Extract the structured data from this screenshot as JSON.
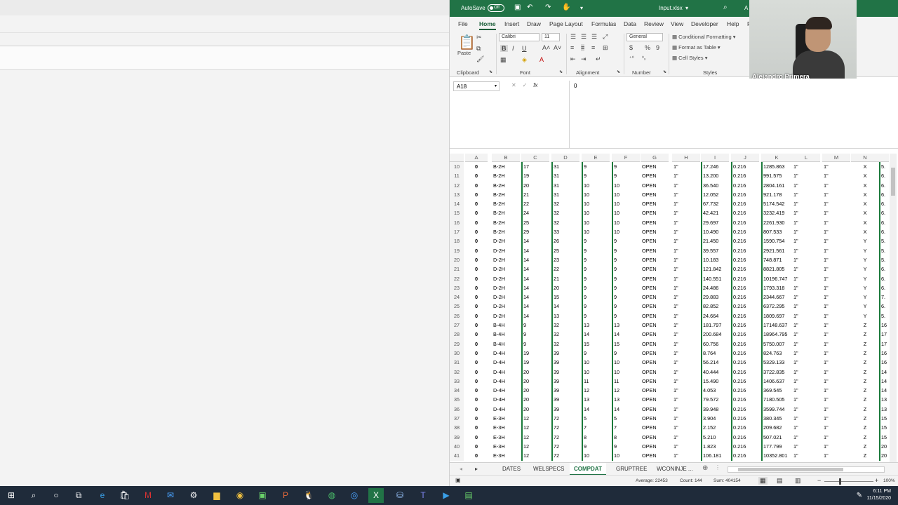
{
  "excel": {
    "autosave": "AutoSave",
    "autosave_state": "Off",
    "filename": "Input.xlsx",
    "title_extra": "A",
    "tabs": [
      "File",
      "Home",
      "Insert",
      "Draw",
      "Page Layout",
      "Formulas",
      "Data",
      "Review",
      "View",
      "Developer",
      "Help",
      "F"
    ],
    "active_tab": "Home",
    "clipboard": {
      "paste": "Paste",
      "group": "Clipboard"
    },
    "font": {
      "name": "Calibri",
      "size": "11",
      "group": "Font"
    },
    "alignment": {
      "group": "Alignment"
    },
    "number": {
      "format": "General",
      "currency": "$",
      "percent": "%",
      "comma": "9",
      "group": "Number"
    },
    "styles": {
      "conditional": "Conditional Formatting",
      "format_table": "Format as Table",
      "cell_styles": "Cell Styles",
      "group": "Styles"
    },
    "name_box": "A18",
    "formula_value": "0",
    "columns": [
      "A",
      "B",
      "C",
      "D",
      "E",
      "F",
      "G",
      "H",
      "I",
      "J",
      "K",
      "L",
      "M",
      "N"
    ],
    "rows": [
      {
        "r": "10",
        "a": "0",
        "b": "B-2H",
        "c": "17",
        "d": "31",
        "e": "9",
        "f": "9",
        "g": "OPEN",
        "h": "1\"",
        "i": "17.246",
        "j": "0.216",
        "k": "1285.863",
        "l": "1\"",
        "m": "1\"",
        "n": "X",
        "o": "5."
      },
      {
        "r": "11",
        "a": "0",
        "b": "B-2H",
        "c": "19",
        "d": "31",
        "e": "9",
        "f": "9",
        "g": "OPEN",
        "h": "1\"",
        "i": "13.200",
        "j": "0.216",
        "k": "991.575",
        "l": "1\"",
        "m": "1\"",
        "n": "X",
        "o": "6."
      },
      {
        "r": "12",
        "a": "0",
        "b": "B-2H",
        "c": "20",
        "d": "31",
        "e": "10",
        "f": "10",
        "g": "OPEN",
        "h": "1\"",
        "i": "36.540",
        "j": "0.216",
        "k": "2804.161",
        "l": "1\"",
        "m": "1\"",
        "n": "X",
        "o": "6."
      },
      {
        "r": "13",
        "a": "0",
        "b": "B-2H",
        "c": "21",
        "d": "31",
        "e": "10",
        "f": "10",
        "g": "OPEN",
        "h": "1\"",
        "i": "12.052",
        "j": "0.216",
        "k": "921.178",
        "l": "1\"",
        "m": "1\"",
        "n": "X",
        "o": "6."
      },
      {
        "r": "14",
        "a": "0",
        "b": "B-2H",
        "c": "22",
        "d": "32",
        "e": "10",
        "f": "10",
        "g": "OPEN",
        "h": "1\"",
        "i": "67.732",
        "j": "0.216",
        "k": "5174.542",
        "l": "1\"",
        "m": "1\"",
        "n": "X",
        "o": "6."
      },
      {
        "r": "15",
        "a": "0",
        "b": "B-2H",
        "c": "24",
        "d": "32",
        "e": "10",
        "f": "10",
        "g": "OPEN",
        "h": "1\"",
        "i": "42.421",
        "j": "0.216",
        "k": "3232.419",
        "l": "1\"",
        "m": "1\"",
        "n": "X",
        "o": "6."
      },
      {
        "r": "16",
        "a": "0",
        "b": "B-2H",
        "c": "25",
        "d": "32",
        "e": "10",
        "f": "10",
        "g": "OPEN",
        "h": "1\"",
        "i": "29.697",
        "j": "0.216",
        "k": "2261.930",
        "l": "1\"",
        "m": "1\"",
        "n": "X",
        "o": "6."
      },
      {
        "r": "17",
        "a": "0",
        "b": "B-2H",
        "c": "29",
        "d": "33",
        "e": "10",
        "f": "10",
        "g": "OPEN",
        "h": "1\"",
        "i": "10.490",
        "j": "0.216",
        "k": "807.533",
        "l": "1\"",
        "m": "1\"",
        "n": "X",
        "o": "6."
      },
      {
        "r": "18",
        "a": "0",
        "b": "D-2H",
        "c": "14",
        "d": "26",
        "e": "9",
        "f": "9",
        "g": "OPEN",
        "h": "1\"",
        "i": "21.450",
        "j": "0.216",
        "k": "1590.754",
        "l": "1\"",
        "m": "1\"",
        "n": "Y",
        "o": "5."
      },
      {
        "r": "19",
        "a": "0",
        "b": "D-2H",
        "c": "14",
        "d": "25",
        "e": "9",
        "f": "9",
        "g": "OPEN",
        "h": "1\"",
        "i": "39.557",
        "j": "0.216",
        "k": "2921.561",
        "l": "1\"",
        "m": "1\"",
        "n": "Y",
        "o": "5."
      },
      {
        "r": "20",
        "a": "0",
        "b": "D-2H",
        "c": "14",
        "d": "23",
        "e": "9",
        "f": "9",
        "g": "OPEN",
        "h": "1\"",
        "i": "10.183",
        "j": "0.216",
        "k": "748.871",
        "l": "1\"",
        "m": "1\"",
        "n": "Y",
        "o": "5."
      },
      {
        "r": "21",
        "a": "0",
        "b": "D-2H",
        "c": "14",
        "d": "22",
        "e": "9",
        "f": "9",
        "g": "OPEN",
        "h": "1\"",
        "i": "121.842",
        "j": "0.216",
        "k": "8821.805",
        "l": "1\"",
        "m": "1\"",
        "n": "Y",
        "o": "6."
      },
      {
        "r": "22",
        "a": "0",
        "b": "D-2H",
        "c": "14",
        "d": "21",
        "e": "9",
        "f": "9",
        "g": "OPEN",
        "h": "1\"",
        "i": "140.551",
        "j": "0.216",
        "k": "10196.747",
        "l": "1\"",
        "m": "1\"",
        "n": "Y",
        "o": "6."
      },
      {
        "r": "23",
        "a": "0",
        "b": "D-2H",
        "c": "14",
        "d": "20",
        "e": "9",
        "f": "9",
        "g": "OPEN",
        "h": "1\"",
        "i": "24.486",
        "j": "0.216",
        "k": "1793.318",
        "l": "1\"",
        "m": "1\"",
        "n": "Y",
        "o": "6."
      },
      {
        "r": "24",
        "a": "0",
        "b": "D-2H",
        "c": "14",
        "d": "15",
        "e": "9",
        "f": "9",
        "g": "OPEN",
        "h": "1\"",
        "i": "29.883",
        "j": "0.216",
        "k": "2344.667",
        "l": "1\"",
        "m": "1\"",
        "n": "Y",
        "o": "7."
      },
      {
        "r": "25",
        "a": "0",
        "b": "D-2H",
        "c": "14",
        "d": "14",
        "e": "9",
        "f": "9",
        "g": "OPEN",
        "h": "1\"",
        "i": "82.852",
        "j": "0.216",
        "k": "6372.295",
        "l": "1\"",
        "m": "1\"",
        "n": "Y",
        "o": "6."
      },
      {
        "r": "26",
        "a": "0",
        "b": "D-2H",
        "c": "14",
        "d": "13",
        "e": "9",
        "f": "9",
        "g": "OPEN",
        "h": "1\"",
        "i": "24.664",
        "j": "0.216",
        "k": "1809.697",
        "l": "1\"",
        "m": "1\"",
        "n": "Y",
        "o": "5."
      },
      {
        "r": "27",
        "a": "0",
        "b": "B-4H",
        "c": "9",
        "d": "32",
        "e": "13",
        "f": "13",
        "g": "OPEN",
        "h": "1\"",
        "i": "181.797",
        "j": "0.216",
        "k": "17148.637",
        "l": "1\"",
        "m": "1\"",
        "n": "Z",
        "o": "16"
      },
      {
        "r": "28",
        "a": "0",
        "b": "B-4H",
        "c": "9",
        "d": "32",
        "e": "14",
        "f": "14",
        "g": "OPEN",
        "h": "1\"",
        "i": "200.684",
        "j": "0.216",
        "k": "18964.795",
        "l": "1\"",
        "m": "1\"",
        "n": "Z",
        "o": "17"
      },
      {
        "r": "29",
        "a": "0",
        "b": "B-4H",
        "c": "9",
        "d": "32",
        "e": "15",
        "f": "15",
        "g": "OPEN",
        "h": "1\"",
        "i": "60.756",
        "j": "0.216",
        "k": "5750.007",
        "l": "1\"",
        "m": "1\"",
        "n": "Z",
        "o": "17"
      },
      {
        "r": "30",
        "a": "0",
        "b": "D-4H",
        "c": "19",
        "d": "39",
        "e": "9",
        "f": "9",
        "g": "OPEN",
        "h": "1\"",
        "i": "8.764",
        "j": "0.216",
        "k": "824.763",
        "l": "1\"",
        "m": "1\"",
        "n": "Z",
        "o": "16"
      },
      {
        "r": "31",
        "a": "0",
        "b": "D-4H",
        "c": "19",
        "d": "39",
        "e": "10",
        "f": "10",
        "g": "OPEN",
        "h": "1\"",
        "i": "56.214",
        "j": "0.216",
        "k": "5329.133",
        "l": "1\"",
        "m": "1\"",
        "n": "Z",
        "o": "16"
      },
      {
        "r": "32",
        "a": "0",
        "b": "D-4H",
        "c": "20",
        "d": "39",
        "e": "10",
        "f": "10",
        "g": "OPEN",
        "h": "1\"",
        "i": "40.444",
        "j": "0.216",
        "k": "3722.835",
        "l": "1\"",
        "m": "1\"",
        "n": "Z",
        "o": "14"
      },
      {
        "r": "33",
        "a": "0",
        "b": "D-4H",
        "c": "20",
        "d": "39",
        "e": "11",
        "f": "11",
        "g": "OPEN",
        "h": "1\"",
        "i": "15.490",
        "j": "0.216",
        "k": "1406.637",
        "l": "1\"",
        "m": "1\"",
        "n": "Z",
        "o": "14"
      },
      {
        "r": "34",
        "a": "0",
        "b": "D-4H",
        "c": "20",
        "d": "39",
        "e": "12",
        "f": "12",
        "g": "OPEN",
        "h": "1\"",
        "i": "4.053",
        "j": "0.216",
        "k": "369.545",
        "l": "1\"",
        "m": "1\"",
        "n": "Z",
        "o": "14"
      },
      {
        "r": "35",
        "a": "0",
        "b": "D-4H",
        "c": "20",
        "d": "39",
        "e": "13",
        "f": "13",
        "g": "OPEN",
        "h": "1\"",
        "i": "79.572",
        "j": "0.216",
        "k": "7180.505",
        "l": "1\"",
        "m": "1\"",
        "n": "Z",
        "o": "13"
      },
      {
        "r": "36",
        "a": "0",
        "b": "D-4H",
        "c": "20",
        "d": "39",
        "e": "14",
        "f": "14",
        "g": "OPEN",
        "h": "1\"",
        "i": "39.948",
        "j": "0.216",
        "k": "3599.744",
        "l": "1\"",
        "m": "1\"",
        "n": "Z",
        "o": "13"
      },
      {
        "r": "37",
        "a": "0",
        "b": "E-3H",
        "c": "12",
        "d": "72",
        "e": "5",
        "f": "5",
        "g": "OPEN",
        "h": "1\"",
        "i": "3.904",
        "j": "0.216",
        "k": "380.345",
        "l": "1\"",
        "m": "1\"",
        "n": "Z",
        "o": "15"
      },
      {
        "r": "38",
        "a": "0",
        "b": "E-3H",
        "c": "12",
        "d": "72",
        "e": "7",
        "f": "7",
        "g": "OPEN",
        "h": "1\"",
        "i": "2.152",
        "j": "0.216",
        "k": "209.682",
        "l": "1\"",
        "m": "1\"",
        "n": "Z",
        "o": "15"
      },
      {
        "r": "39",
        "a": "0",
        "b": "E-3H",
        "c": "12",
        "d": "72",
        "e": "8",
        "f": "8",
        "g": "OPEN",
        "h": "1\"",
        "i": "5.210",
        "j": "0.216",
        "k": "507.021",
        "l": "1\"",
        "m": "1\"",
        "n": "Z",
        "o": "15"
      },
      {
        "r": "40",
        "a": "0",
        "b": "E-3H",
        "c": "12",
        "d": "72",
        "e": "9",
        "f": "9",
        "g": "OPEN",
        "h": "1\"",
        "i": "1.823",
        "j": "0.216",
        "k": "177.799",
        "l": "1\"",
        "m": "1\"",
        "n": "Z",
        "o": "20"
      },
      {
        "r": "41",
        "a": "0",
        "b": "E-3H",
        "c": "12",
        "d": "72",
        "e": "10",
        "f": "10",
        "g": "OPEN",
        "h": "1\"",
        "i": "106.181",
        "j": "0.216",
        "k": "10352.801",
        "l": "1\"",
        "m": "1\"",
        "n": "Z",
        "o": "20"
      }
    ],
    "sheet_tabs": [
      "DATES",
      "WELSPECS",
      "COMPDAT",
      "GRUPTREE",
      "WCONINJE ..."
    ],
    "active_sheet": "COMPDAT",
    "status": {
      "average": "Average: 22453",
      "count": "Count: 144",
      "sum": "Sum: 404154",
      "zoom": "100%"
    }
  },
  "webcam": {
    "name": "Alejandro Primera"
  },
  "taskbar": {
    "time": "6:11 PM",
    "date": "11/15/2020"
  }
}
